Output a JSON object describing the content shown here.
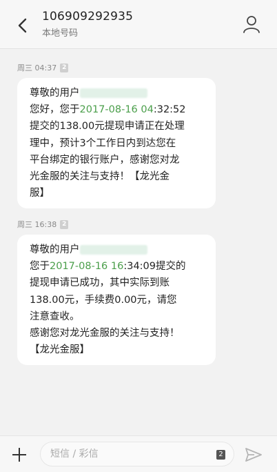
{
  "header": {
    "title": "106909292935",
    "subtitle": "本地号码"
  },
  "messages": [
    {
      "time": "周三 04:37",
      "sim": "2",
      "lines": [
        {
          "parts": [
            "尊敬的用户"
          ]
        },
        {
          "parts": [
            "您好，您于",
            "2017-08-16 04",
            ":32:52"
          ]
        },
        {
          "parts": [
            "提交的138.00元提现申请正在处理"
          ]
        },
        {
          "parts": [
            "理中，预计3个工作日内到达您在"
          ]
        },
        {
          "parts": [
            "平台绑定的银行账户，感谢您对龙"
          ]
        },
        {
          "parts": [
            "光金服的关注与支持！【龙光金"
          ]
        },
        {
          "parts": [
            "服】"
          ]
        }
      ]
    },
    {
      "time": "周三 16:38",
      "sim": "2",
      "lines": [
        {
          "parts": [
            "尊敬的用户"
          ]
        },
        {
          "parts": [
            "您于",
            "2017-08-16 16",
            ":34:09提交的"
          ]
        },
        {
          "parts": [
            "提现申请已成功，其中实际到账"
          ]
        },
        {
          "parts": [
            "138.00元，手续费0.00元，请您"
          ]
        },
        {
          "parts": [
            "注意查收。"
          ]
        },
        {
          "parts": [
            "感谢您对龙光金服的关注与支持！"
          ]
        },
        {
          "parts": [
            "【龙光金服】"
          ]
        }
      ]
    }
  ],
  "composer": {
    "placeholder": "短信 / 彩信",
    "sim": "2"
  },
  "colors": {
    "date_highlight": "#4a9e4a",
    "bubble": "#ffffff",
    "background": "#f2f2f2"
  },
  "icons": {
    "back": "chevron-left-icon",
    "contact": "person-icon",
    "add": "plus-icon",
    "send": "send-icon"
  }
}
